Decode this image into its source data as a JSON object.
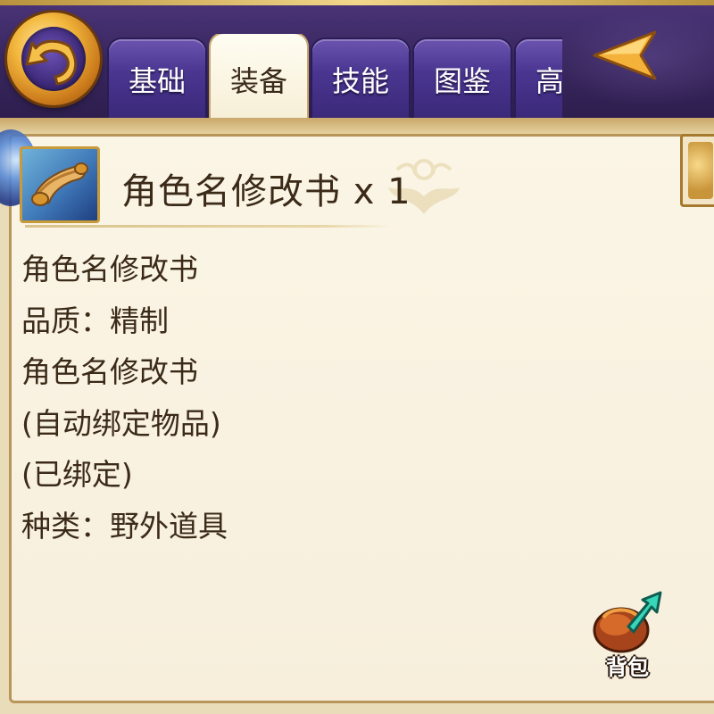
{
  "header": {
    "back_icon": "back-arrow-icon",
    "tabs": [
      {
        "label": "基础",
        "active": false
      },
      {
        "label": "装备",
        "active": true
      },
      {
        "label": "技能",
        "active": false
      },
      {
        "label": "图鉴",
        "active": false
      },
      {
        "label": "高",
        "active": false
      }
    ],
    "scroll_arrow_icon": "arrow-left-icon"
  },
  "item": {
    "icon": "scroll-icon",
    "title": "角色名修改书 x 1",
    "details": [
      "角色名修改书",
      "品质：精制",
      "角色名修改书",
      "(自动绑定物品)",
      "(已绑定)",
      "种类：野外道具"
    ]
  },
  "backpack": {
    "icon": "backpack-icon",
    "label": "背包"
  },
  "colors": {
    "header_purple": "#3a2860",
    "tab_purple": "#4a3690",
    "tab_active": "#fffdf2",
    "panel_bg": "#f7efdc",
    "gold": "#f3b83d",
    "text_brown": "#3b2a18"
  }
}
